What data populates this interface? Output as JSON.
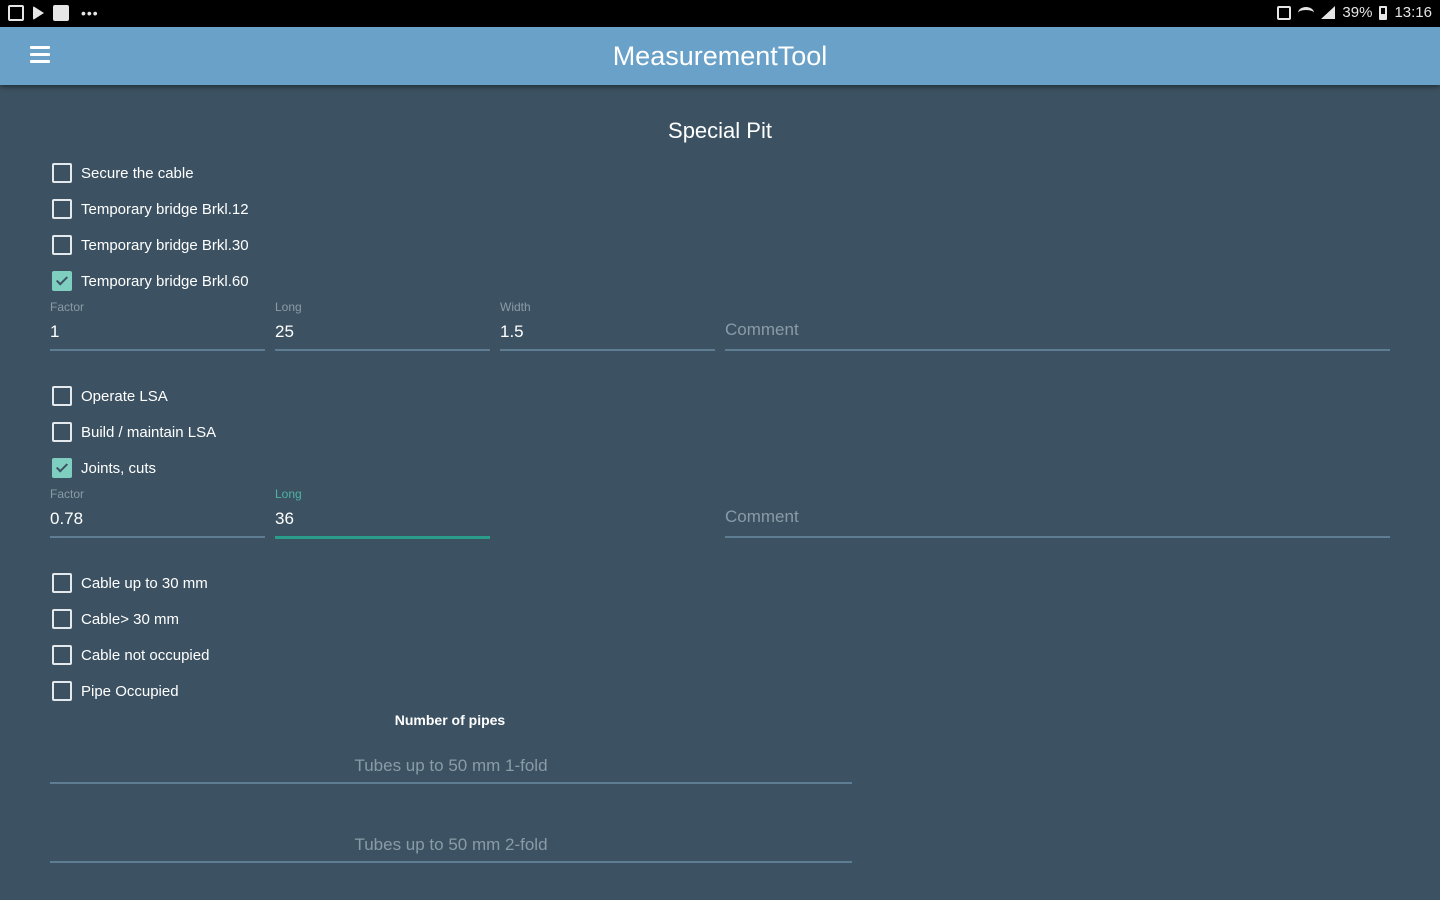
{
  "status_bar": {
    "left_icons": [
      "image-icon",
      "play-store-icon",
      "edit-icon",
      "more-dots-icon"
    ],
    "more": "•••",
    "battery": "39%",
    "time": "13:16"
  },
  "app_bar": {
    "title": "MeasurementTool",
    "menu_icon": "hamburger-menu-icon",
    "color": "#6aa1c9"
  },
  "section": {
    "title": "Special Pit"
  },
  "group1": {
    "checkboxes": [
      {
        "label": "Secure the cable",
        "checked": false
      },
      {
        "label": "Temporary bridge Brkl.12",
        "checked": false
      },
      {
        "label": "Temporary bridge Brkl.30",
        "checked": false
      },
      {
        "label": "Temporary bridge Brkl.60",
        "checked": true
      }
    ],
    "factor": {
      "label": "Factor",
      "value": "1"
    },
    "long": {
      "label": "Long",
      "value": "25"
    },
    "width": {
      "label": "Width",
      "value": "1.5"
    },
    "comment": {
      "placeholder": "Comment"
    }
  },
  "group2": {
    "checkboxes": [
      {
        "label": "Operate LSA",
        "checked": false
      },
      {
        "label": "Build / maintain LSA",
        "checked": false
      },
      {
        "label": "Joints, cuts",
        "checked": true
      }
    ],
    "factor": {
      "label": "Factor",
      "value": "0.78"
    },
    "long": {
      "label": "Long",
      "value": "36"
    },
    "comment": {
      "placeholder": "Comment"
    }
  },
  "group3": {
    "checkboxes": [
      {
        "label": "Cable up to 30 mm",
        "checked": false
      },
      {
        "label": "Cable> 30 mm",
        "checked": false
      },
      {
        "label": "Cable not occupied",
        "checked": false
      },
      {
        "label": "Pipe Occupied",
        "checked": false
      }
    ],
    "pipes_label": "Number of pipes",
    "tubes": [
      {
        "placeholder": "Tubes up to 50 mm 1-fold"
      },
      {
        "placeholder": "Tubes up to 50 mm 2-fold"
      }
    ]
  },
  "colors": {
    "background": "#3c5262",
    "accent": "#7fcfc0",
    "focus_line": "#2a9d8a"
  }
}
